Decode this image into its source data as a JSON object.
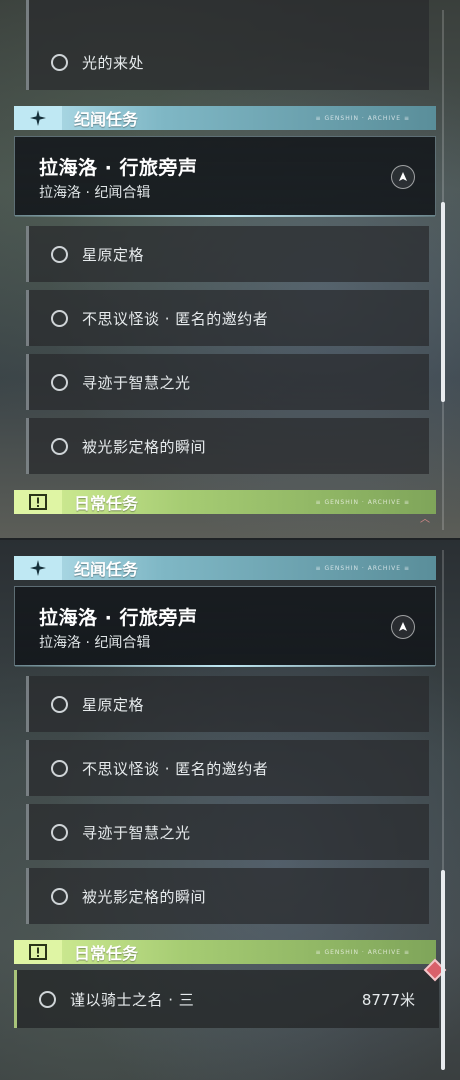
{
  "panel_top": {
    "cut_row": {
      "label": "光的来处"
    },
    "story_header": {
      "title": "纪闻任务",
      "deco": "≡ GENSHIN · ARCHIVE ≡"
    },
    "quest_card": {
      "title": "拉海洛 · 行旅旁声",
      "subtitle": "拉海洛 · 纪闻合辑"
    },
    "rows": [
      {
        "label": "星原定格"
      },
      {
        "label": "不思议怪谈 · 匿名的邀约者"
      },
      {
        "label": "寻迹于智慧之光"
      },
      {
        "label": "被光影定格的瞬间"
      }
    ],
    "daily_header": {
      "title": "日常任务",
      "deco": "≡ GENSHIN · ARCHIVE ≡"
    },
    "scroll_position": 0.6
  },
  "panel_bottom": {
    "story_header": {
      "title": "纪闻任务",
      "deco": "≡ GENSHIN · ARCHIVE ≡"
    },
    "quest_card": {
      "title": "拉海洛 · 行旅旁声",
      "subtitle": "拉海洛 · 纪闻合辑"
    },
    "rows": [
      {
        "label": "星原定格"
      },
      {
        "label": "不思议怪谈 · 匿名的邀约者"
      },
      {
        "label": "寻迹于智慧之光"
      },
      {
        "label": "被光影定格的瞬间"
      }
    ],
    "daily_header": {
      "title": "日常任务",
      "deco": "≡ GENSHIN · ARCHIVE ≡"
    },
    "daily_quest": {
      "label": "谨以骑士之名 · 三",
      "distance": "8777米"
    },
    "scroll_position": 1.0
  },
  "colors": {
    "story_accent": "#bfe8f3",
    "daily_accent": "#dff5a4",
    "marker": "#d9606a"
  },
  "icons": {
    "story": "four-point-star-icon",
    "daily": "exclamation-box-icon",
    "track": "compass-arrow-icon",
    "status": "empty-circle-icon",
    "marker": "red-diamond-marker-icon"
  }
}
